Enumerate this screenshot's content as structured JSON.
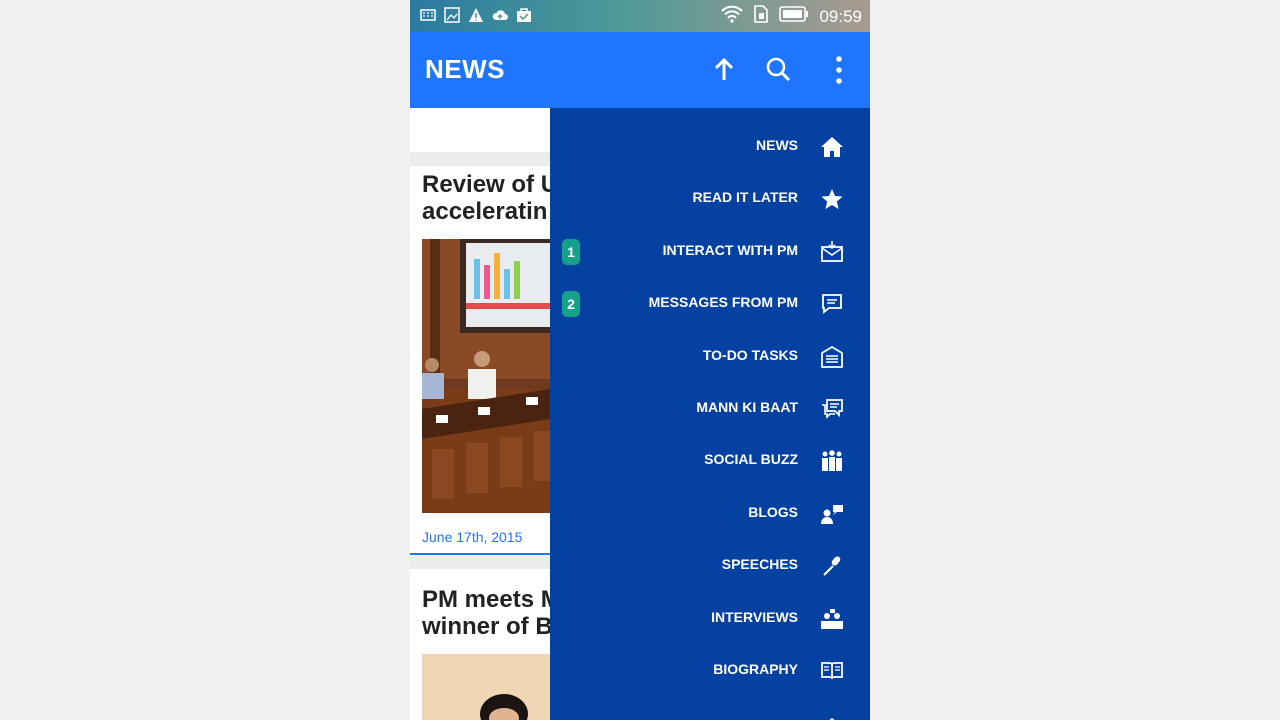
{
  "status_bar": {
    "time": "09:59",
    "left_icons": [
      "keyboard-icon",
      "image-icon",
      "warning-icon",
      "cloud-upload-icon",
      "shopping-bag-icon"
    ],
    "right_icons": [
      "wifi-icon",
      "sim-icon",
      "battery-icon"
    ]
  },
  "app_bar": {
    "title": "NEWS",
    "actions": [
      "arrow-up-icon",
      "search-icon",
      "more-vert-icon"
    ]
  },
  "articles": [
    {
      "title_line1": "Review of U",
      "title_line2": "acceleratin",
      "date": "June 17th, 2015"
    },
    {
      "title_line1": "PM meets M",
      "title_line2": "winner of B",
      "date": ""
    }
  ],
  "drawer": {
    "items": [
      {
        "label": "NEWS",
        "icon": "home-icon",
        "badge": ""
      },
      {
        "label": "READ IT LATER",
        "icon": "star-icon",
        "badge": ""
      },
      {
        "label": "INTERACT WITH PM",
        "icon": "mail-icon",
        "badge": "1"
      },
      {
        "label": "MESSAGES FROM PM",
        "icon": "chat-icon",
        "badge": "2"
      },
      {
        "label": "TO-DO TASKS",
        "icon": "tasks-icon",
        "badge": ""
      },
      {
        "label": "MANN KI BAAT",
        "icon": "talk-icon",
        "badge": ""
      },
      {
        "label": "SOCIAL BUZZ",
        "icon": "people-icon",
        "badge": ""
      },
      {
        "label": "BLOGS",
        "icon": "blog-icon",
        "badge": ""
      },
      {
        "label": "SPEECHES",
        "icon": "microphone-icon",
        "badge": ""
      },
      {
        "label": "INTERVIEWS",
        "icon": "interview-icon",
        "badge": ""
      },
      {
        "label": "BIOGRAPHY",
        "icon": "book-icon",
        "badge": ""
      }
    ]
  },
  "colors": {
    "app_bar": "#1f75fe",
    "drawer": "#0441a1",
    "badge": "#15a08a",
    "date": "#1f75fe"
  }
}
